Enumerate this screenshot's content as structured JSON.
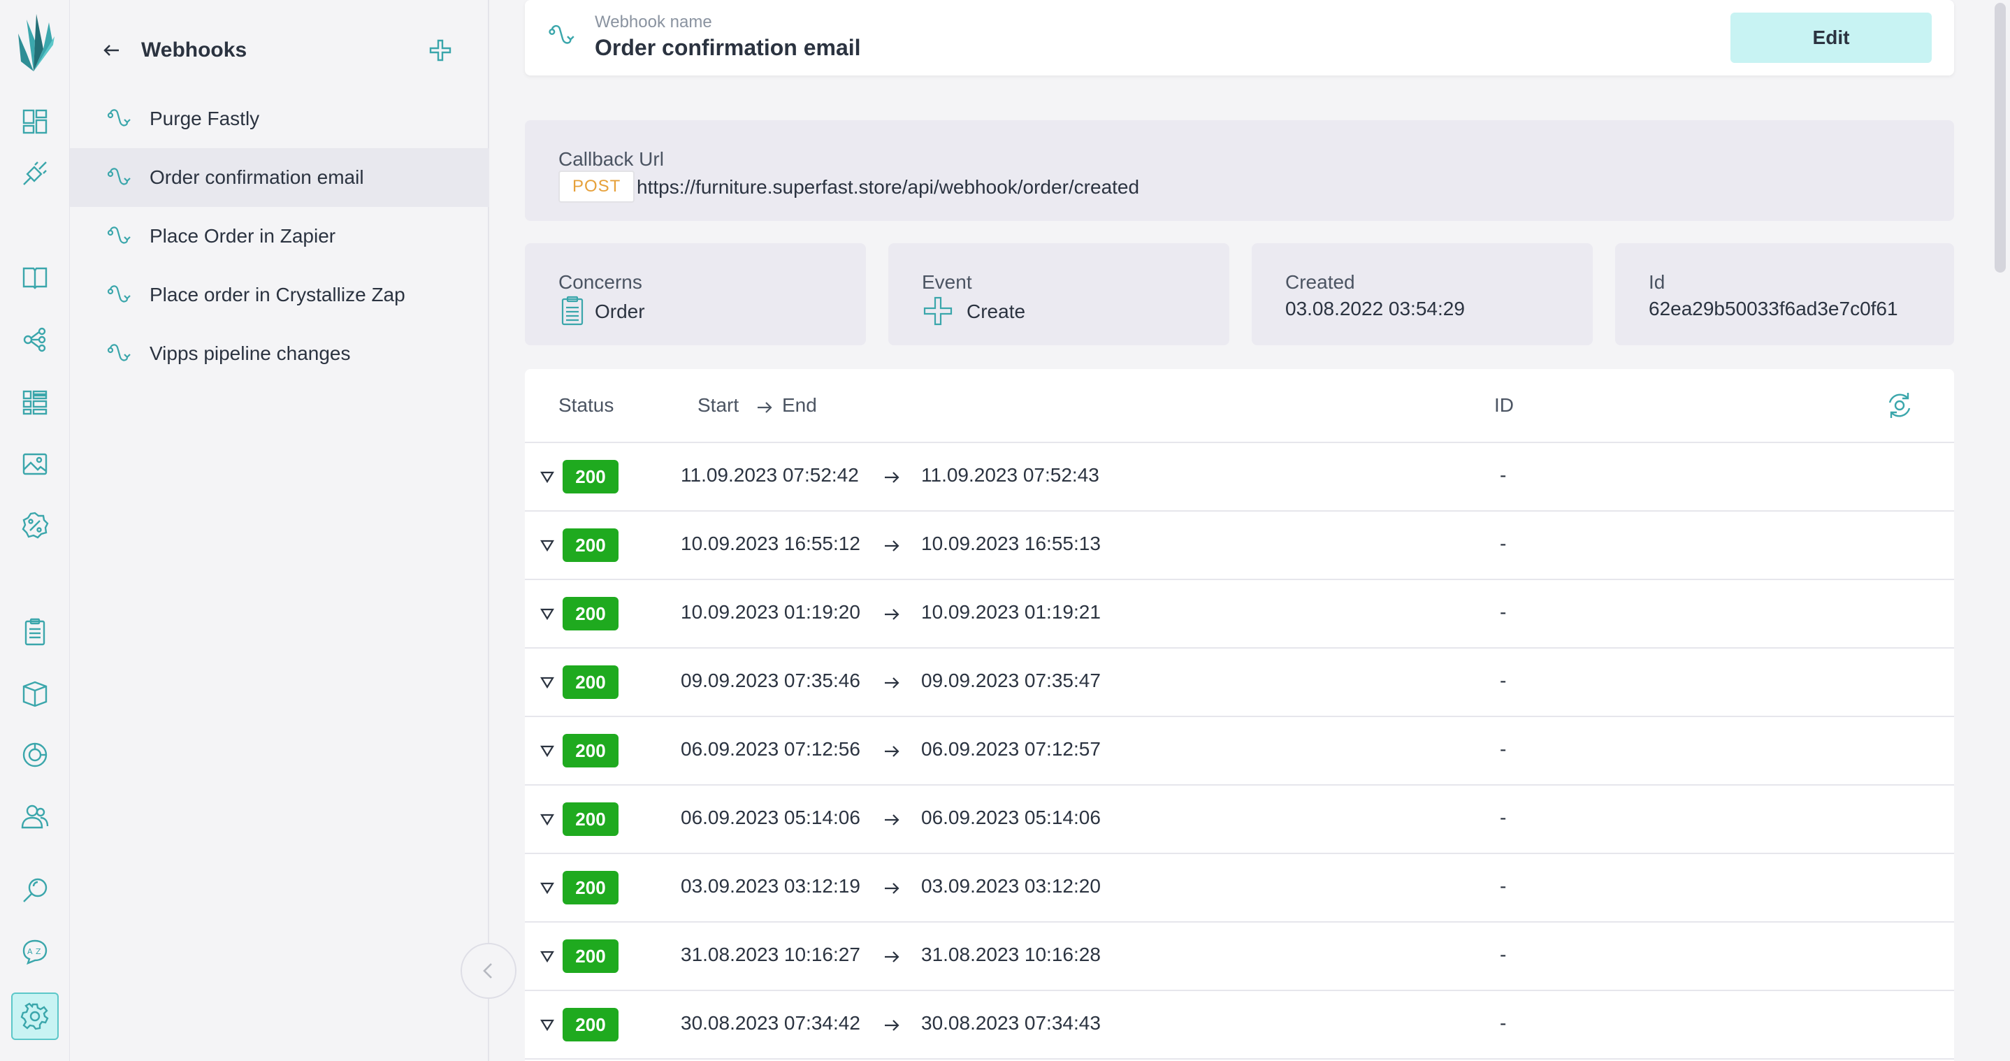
{
  "app": {
    "colors": {
      "accent": "#5cc7c9",
      "accent_bg": "#c8f3f3",
      "success": "#1faa1f",
      "method": "#e6a03a"
    }
  },
  "rail": {
    "icons": [
      "dashboard-icon",
      "integration-icon",
      "catalogue-icon",
      "graph-icon",
      "grid-icon",
      "media-icon",
      "discount-icon",
      "orders-icon",
      "product-box-icon",
      "analytics-icon",
      "customers-icon",
      "search-icon",
      "translate-icon",
      "settings-icon"
    ],
    "active": "settings-icon"
  },
  "sidebar": {
    "title": "Webhooks",
    "items": [
      {
        "label": "Purge Fastly"
      },
      {
        "label": "Order confirmation email"
      },
      {
        "label": "Place Order in Zapier"
      },
      {
        "label": "Place order in Crystallize Zap"
      },
      {
        "label": "Vipps pipeline changes"
      }
    ],
    "selected_index": 1
  },
  "header": {
    "subtitle": "Webhook name",
    "name": "Order confirmation email",
    "edit_label": "Edit"
  },
  "callback": {
    "label": "Callback Url",
    "method": "POST",
    "url": "https://furniture.superfast.store/api/webhook/order/created"
  },
  "details": {
    "concerns_label": "Concerns",
    "concerns_value": "Order",
    "event_label": "Event",
    "event_value": "Create",
    "created_label": "Created",
    "created_value": "03.08.2022 03:54:29",
    "id_label": "Id",
    "id_value": "62ea29b50033f6ad3e7c0f61"
  },
  "table": {
    "headers": {
      "status": "Status",
      "start": "Start",
      "end": "End",
      "id": "ID"
    },
    "rows": [
      {
        "status": "200",
        "start": "11.09.2023 07:52:42",
        "end": "11.09.2023 07:52:43",
        "id": "-"
      },
      {
        "status": "200",
        "start": "10.09.2023 16:55:12",
        "end": "10.09.2023 16:55:13",
        "id": "-"
      },
      {
        "status": "200",
        "start": "10.09.2023 01:19:20",
        "end": "10.09.2023 01:19:21",
        "id": "-"
      },
      {
        "status": "200",
        "start": "09.09.2023 07:35:46",
        "end": "09.09.2023 07:35:47",
        "id": "-"
      },
      {
        "status": "200",
        "start": "06.09.2023 07:12:56",
        "end": "06.09.2023 07:12:57",
        "id": "-"
      },
      {
        "status": "200",
        "start": "06.09.2023 05:14:06",
        "end": "06.09.2023 05:14:06",
        "id": "-"
      },
      {
        "status": "200",
        "start": "03.09.2023 03:12:19",
        "end": "03.09.2023 03:12:20",
        "id": "-"
      },
      {
        "status": "200",
        "start": "31.08.2023 10:16:27",
        "end": "31.08.2023 10:16:28",
        "id": "-"
      },
      {
        "status": "200",
        "start": "30.08.2023 07:34:42",
        "end": "30.08.2023 07:34:43",
        "id": "-"
      }
    ]
  }
}
